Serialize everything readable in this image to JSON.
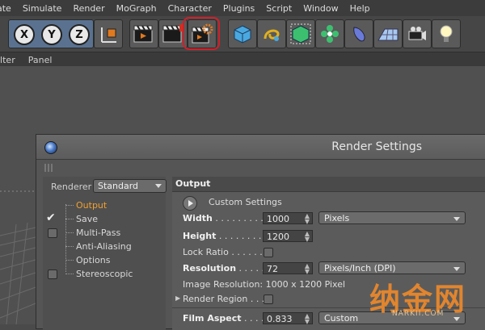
{
  "menubar": {
    "items": [
      "ate",
      "Simulate",
      "Render",
      "MoGraph",
      "Character",
      "Plugins",
      "Script",
      "Window",
      "Help"
    ]
  },
  "toolbar": {
    "axes": [
      "X",
      "Y",
      "Z"
    ],
    "buttons": [
      "world-axis-icon",
      "render-view-icon",
      "render-picture-viewer-icon",
      "render-settings-icon",
      "cube-icon",
      "spline-pen-icon",
      "subdivision-icon",
      "cloner-icon",
      "deformer-icon",
      "floor-icon",
      "camera-icon",
      "light-icon"
    ]
  },
  "subbar": {
    "items": [
      "ilter",
      "Panel"
    ]
  },
  "dialog": {
    "title": "Render Settings",
    "renderer_label": "Renderer",
    "renderer_value": "Standard",
    "tree": [
      {
        "label": "Output",
        "checked": null,
        "active": true
      },
      {
        "label": "Save",
        "checked": true,
        "active": false
      },
      {
        "label": "Multi-Pass",
        "checked": false,
        "active": false
      },
      {
        "label": "Anti-Aliasing",
        "checked": null,
        "active": false
      },
      {
        "label": "Options",
        "checked": null,
        "active": false
      },
      {
        "label": "Stereoscopic",
        "checked": false,
        "active": false
      }
    ],
    "section_title": "Output",
    "custom_settings": "Custom Settings",
    "width": {
      "label": "Width",
      "dots": " . . . . . . . . . . ",
      "value": "1000",
      "unit": "Pixels"
    },
    "height": {
      "label": "Height",
      "dots": " . . . . . . . . . . ",
      "value": "1200"
    },
    "lock_ratio": {
      "label": "Lock Ratio",
      "dots": " . . . . . . . "
    },
    "resolution": {
      "label": "Resolution",
      "dots": " . . . . . . ",
      "value": "72",
      "unit": "Pixels/Inch (DPI)"
    },
    "image_resolution": "Image Resolution: 1000 x 1200 Pixel",
    "render_region": {
      "label": "Render Region",
      "dots": " . . . "
    },
    "film_aspect": {
      "label": "Film Aspect",
      "dots": " . . . . . . ",
      "value": "0.833",
      "mode": "Custom"
    }
  },
  "watermark": {
    "text": "纳金网",
    "url": "NARKII.COM"
  },
  "colors": {
    "highlight": "#d0202a",
    "active_tree": "#f0a030",
    "watermark": "#f08a2a"
  }
}
